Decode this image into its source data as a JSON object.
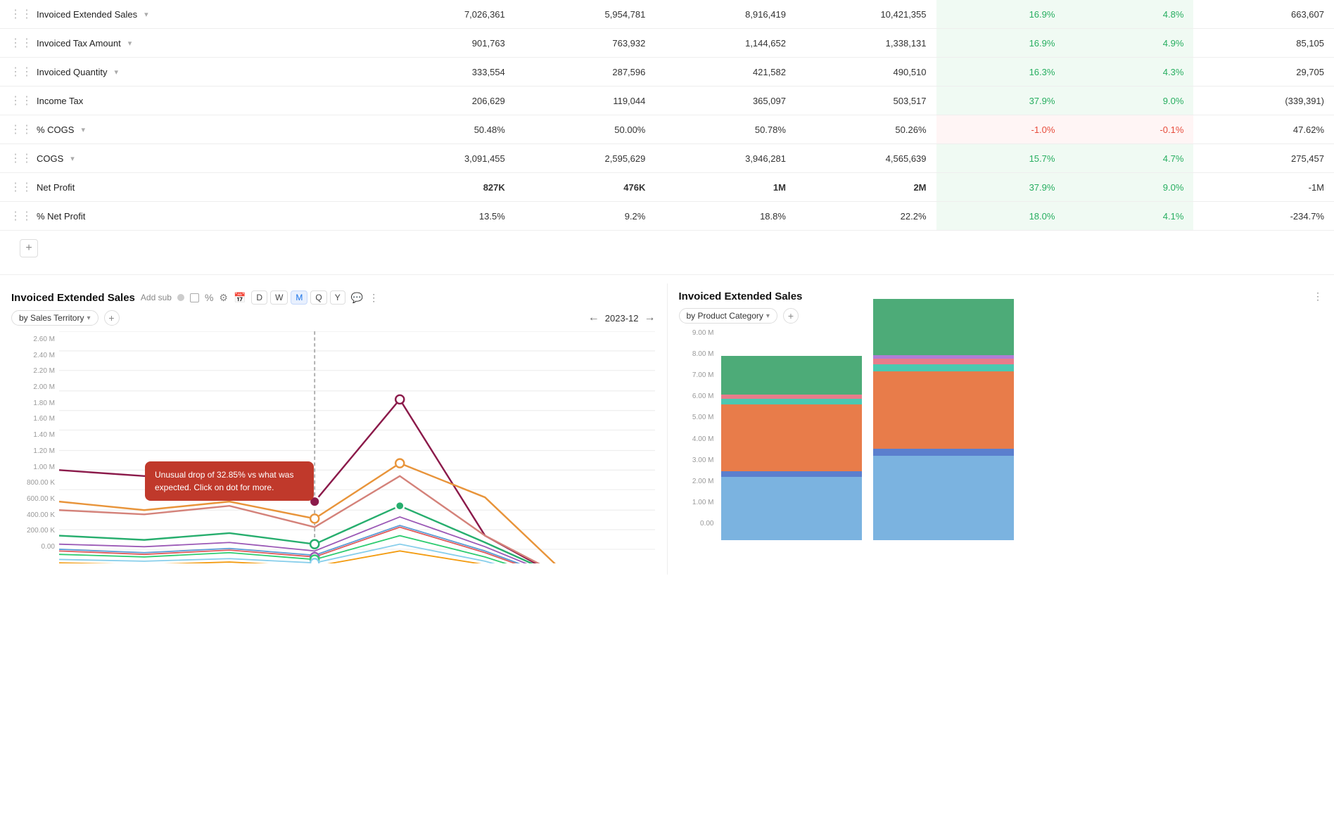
{
  "table": {
    "rows": [
      {
        "id": "invoiced-extended-sales",
        "label": "Invoiced Extended Sales",
        "hasChevron": true,
        "bold": false,
        "vals": [
          "7,026,361",
          "5,954,781",
          "8,916,419",
          "10,421,355"
        ],
        "pct1": "16.9%",
        "pct1Dir": "pos",
        "pct2": "4.8%",
        "pct2Dir": "pos",
        "last": "663,607"
      },
      {
        "id": "invoiced-tax-amount",
        "label": "Invoiced Tax Amount",
        "hasChevron": true,
        "bold": false,
        "vals": [
          "901,763",
          "763,932",
          "1,144,652",
          "1,338,131"
        ],
        "pct1": "16.9%",
        "pct1Dir": "pos",
        "pct2": "4.9%",
        "pct2Dir": "pos",
        "last": "85,105"
      },
      {
        "id": "invoiced-quantity",
        "label": "Invoiced Quantity",
        "hasChevron": true,
        "bold": false,
        "vals": [
          "333,554",
          "287,596",
          "421,582",
          "490,510"
        ],
        "pct1": "16.3%",
        "pct1Dir": "pos",
        "pct2": "4.3%",
        "pct2Dir": "pos",
        "last": "29,705"
      },
      {
        "id": "income-tax",
        "label": "Income Tax",
        "hasChevron": false,
        "bold": false,
        "vals": [
          "206,629",
          "119,044",
          "365,097",
          "503,517"
        ],
        "pct1": "37.9%",
        "pct1Dir": "pos",
        "pct2": "9.0%",
        "pct2Dir": "pos",
        "last": "(339,391)"
      },
      {
        "id": "pct-cogs",
        "label": "% COGS",
        "hasChevron": true,
        "bold": false,
        "vals": [
          "50.48%",
          "50.00%",
          "50.78%",
          "50.26%"
        ],
        "pct1": "-1.0%",
        "pct1Dir": "neg",
        "pct2": "-0.1%",
        "pct2Dir": "neg",
        "last": "47.62%"
      },
      {
        "id": "cogs",
        "label": "COGS",
        "hasChevron": true,
        "bold": false,
        "vals": [
          "3,091,455",
          "2,595,629",
          "3,946,281",
          "4,565,639"
        ],
        "pct1": "15.7%",
        "pct1Dir": "pos",
        "pct2": "4.7%",
        "pct2Dir": "pos",
        "last": "275,457"
      },
      {
        "id": "net-profit",
        "label": "Net Profit",
        "hasChevron": false,
        "bold": true,
        "vals": [
          "827K",
          "476K",
          "1M",
          "2M"
        ],
        "pct1": "37.9%",
        "pct1Dir": "pos",
        "pct2": "9.0%",
        "pct2Dir": "pos",
        "last": "-1M"
      },
      {
        "id": "pct-net-profit",
        "label": "% Net Profit",
        "hasChevron": false,
        "bold": false,
        "vals": [
          "13.5%",
          "9.2%",
          "18.8%",
          "22.2%"
        ],
        "pct1": "18.0%",
        "pct1Dir": "pos",
        "pct2": "4.1%",
        "pct2Dir": "pos",
        "last": "-234.7%"
      }
    ],
    "add_row_label": "+"
  },
  "left_panel": {
    "title": "Invoiced Extended Sales",
    "add_sub_label": "Add sub",
    "toolbar_buttons": [
      "D",
      "W",
      "M",
      "Q",
      "Y"
    ],
    "active_toolbar": "M",
    "nav_period": "2023-12",
    "filter_label": "by Sales Territory",
    "chart_y_labels": [
      "2.60 M",
      "2.40 M",
      "2.20 M",
      "2.00 M",
      "1.80 M",
      "1.60 M",
      "1.40 M",
      "1.20 M",
      "1.00 M",
      "800.00 K",
      "600.00 K",
      "400.00 K",
      "200.00 K",
      "0.00"
    ],
    "tooltip_text": "Unusual drop of 32.85% vs what was expected. Click on dot for more."
  },
  "right_panel": {
    "title": "Invoiced Extended Sales",
    "filter_label": "by Product Category",
    "chart_y_labels": [
      "9.00 M",
      "8.00 M",
      "7.00 M",
      "6.00 M",
      "5.00 M",
      "4.00 M",
      "3.00 M",
      "2.00 M",
      "1.00 M",
      "0.00"
    ],
    "bar_colors": [
      "#7bb3e0",
      "#5b7fce",
      "#e87c4a",
      "#4bc8b0",
      "#e87c8a",
      "#4dab78",
      "#b07dd6"
    ]
  }
}
